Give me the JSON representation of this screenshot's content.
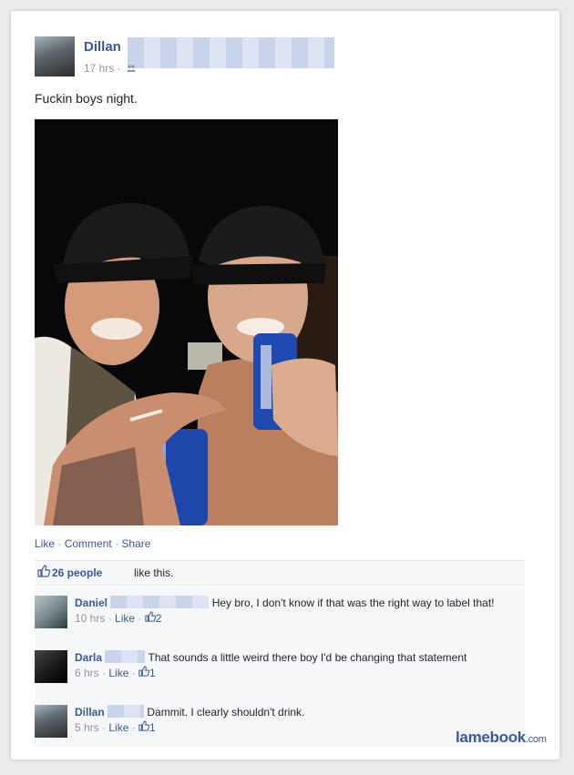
{
  "post": {
    "author": "Dillan",
    "time": "17 hrs",
    "dot": "·",
    "audience_icon": "friends-icon",
    "status": "Fuckin boys night."
  },
  "actions": {
    "like": "Like",
    "comment": "Comment",
    "share": "Share",
    "sep": "·"
  },
  "likes": {
    "count": "26 people",
    "suffix": "like this."
  },
  "comments": [
    {
      "name": "Daniel",
      "text": "Hey bro, I don't know if that was the right way to label that!",
      "time": "10 hrs",
      "like": "Like",
      "likes": "2"
    },
    {
      "name": "Darla",
      "text": "That sounds a little weird there boy I'd be changing that statement",
      "time": "6 hrs",
      "like": "Like",
      "likes": "1"
    },
    {
      "name": "Dillan",
      "text": "Dammit. I clearly shouldn't drink.",
      "time": "5 hrs",
      "like": "Like",
      "likes": "1"
    }
  ],
  "watermark": {
    "brand": "lamebook",
    "domain": ".com"
  },
  "colors": {
    "link": "#3b5998",
    "meta": "#90949c",
    "bg": "#ececec"
  }
}
